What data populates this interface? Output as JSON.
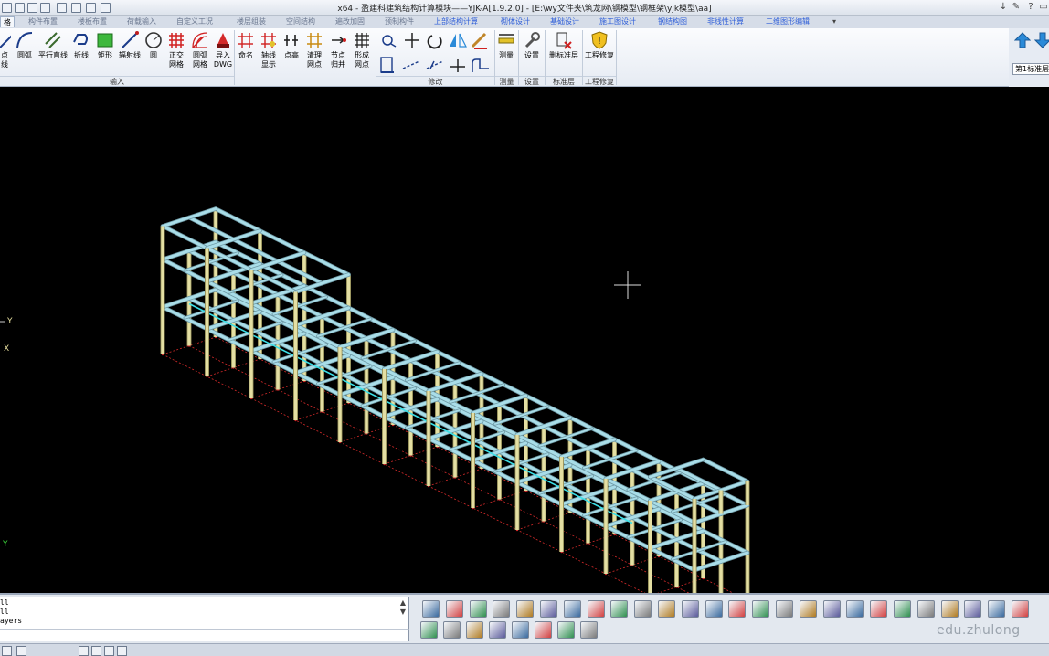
{
  "window": {
    "title": "x64 - 盈建科建筑结构计算模块——YJK-A[1.9.2.0] - [E:\\wy文件夹\\筑龙网\\钢模型\\钢框架\\yjk模型\\aa]"
  },
  "tabs": [
    "格",
    "构件布置",
    "楼板布置",
    "荷载输入",
    "自定义工况",
    "楼层组装",
    "空间结构",
    "遍改加固",
    "预制构件",
    "上部结构计算",
    "砌体设计",
    "基础设计",
    "施工图设计",
    "钢结构图",
    "非线性计算",
    "二维图形编辑"
  ],
  "ribbon": {
    "buttons": [
      {
        "label": "点\n线",
        "icon": "point-line-icon"
      },
      {
        "label": "圆弧",
        "icon": "arc-icon"
      },
      {
        "label": "平行直线",
        "icon": "parallel-line-icon"
      },
      {
        "label": "折线",
        "icon": "polyline-icon"
      },
      {
        "label": "矩形",
        "icon": "rectangle-icon"
      },
      {
        "label": "辐射线",
        "icon": "radial-line-icon"
      },
      {
        "label": "圆",
        "icon": "circle-icon"
      },
      {
        "label": "正交\n网格",
        "icon": "orthogonal-grid-icon"
      },
      {
        "label": "圆弧\n网格",
        "icon": "arc-grid-icon"
      },
      {
        "label": "导入\nDWG",
        "icon": "import-dwg-icon"
      },
      {
        "label": "命名",
        "icon": "rename-icon"
      },
      {
        "label": "轴线\n显示",
        "icon": "axis-display-icon"
      },
      {
        "label": "点高",
        "icon": "point-elevation-icon"
      },
      {
        "label": "清理\n网点",
        "icon": "clean-nodes-icon"
      },
      {
        "label": "节点\n归并",
        "icon": "merge-nodes-icon"
      },
      {
        "label": "形成\n网点",
        "icon": "form-nodes-icon"
      },
      {
        "label": "测量",
        "icon": "measure-icon"
      },
      {
        "label": "设置",
        "icon": "settings-icon"
      },
      {
        "label": "删标准层",
        "icon": "delete-floor-icon"
      },
      {
        "label": "工程修复",
        "icon": "project-repair-icon"
      }
    ],
    "groups": [
      "输入",
      "修改",
      "测量",
      "设置",
      "标准层",
      "工程修复"
    ],
    "floor_selector": "第1标准层"
  },
  "canvas": {
    "axis_labels": {
      "y_upper": "Y",
      "x": "X",
      "y_lower": "Y"
    }
  },
  "command_lines": [
    "ll",
    "ll",
    "ayers"
  ],
  "watermark": "edu.zhulong",
  "colors": {
    "beam": "#a9dde8",
    "column": "#e4dfa3",
    "grid": "#d42a2a",
    "background": "#000000"
  }
}
